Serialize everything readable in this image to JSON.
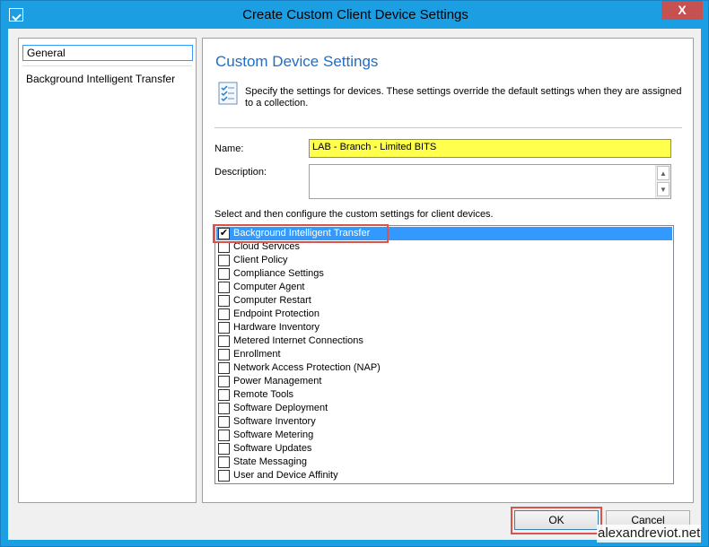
{
  "window": {
    "title": "Create Custom Client Device Settings",
    "close_label": "X"
  },
  "sidebar": {
    "items": [
      {
        "label": "General",
        "selected": true
      },
      {
        "label": "Background Intelligent Transfer",
        "selected": false
      }
    ]
  },
  "main": {
    "heading": "Custom Device Settings",
    "info_line1": "Specify the settings for devices. These settings override the default settings when they are assigned",
    "info_line2": "to a collection.",
    "name_label": "Name:",
    "name_value": "LAB - Branch - Limited BITS",
    "description_label": "Description:",
    "description_value": "",
    "list_caption": "Select and then configure the custom settings for client devices.",
    "settings": [
      {
        "label": "Background Intelligent Transfer",
        "checked": true
      },
      {
        "label": "Cloud Services",
        "checked": false
      },
      {
        "label": "Client Policy",
        "checked": false
      },
      {
        "label": "Compliance Settings",
        "checked": false
      },
      {
        "label": "Computer Agent",
        "checked": false
      },
      {
        "label": "Computer Restart",
        "checked": false
      },
      {
        "label": "Endpoint Protection",
        "checked": false
      },
      {
        "label": "Hardware Inventory",
        "checked": false
      },
      {
        "label": "Metered Internet Connections",
        "checked": false
      },
      {
        "label": "Enrollment",
        "checked": false
      },
      {
        "label": "Network Access Protection (NAP)",
        "checked": false
      },
      {
        "label": "Power Management",
        "checked": false
      },
      {
        "label": "Remote Tools",
        "checked": false
      },
      {
        "label": "Software Deployment",
        "checked": false
      },
      {
        "label": "Software Inventory",
        "checked": false
      },
      {
        "label": "Software Metering",
        "checked": false
      },
      {
        "label": "Software Updates",
        "checked": false
      },
      {
        "label": "State Messaging",
        "checked": false
      },
      {
        "label": "User and Device Affinity",
        "checked": false
      }
    ]
  },
  "footer": {
    "ok_label": "OK",
    "cancel_label": "Cancel"
  },
  "watermark": "alexandreviot.net",
  "colors": {
    "titlebar": "#1b9fe2",
    "heading": "#1e6ec8",
    "selection": "#3399ff",
    "highlight_input": "#ffff4d",
    "annotation": "#d9534f"
  }
}
